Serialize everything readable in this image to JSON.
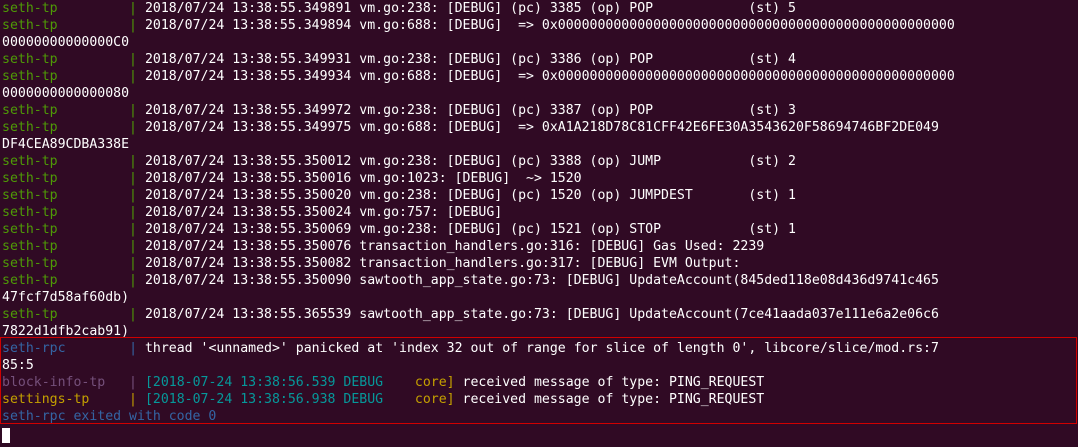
{
  "colors": {
    "background": "#300a24",
    "green": "#4e9a06",
    "blue": "#3465a4",
    "magenta": "#75507b",
    "yellow": "#c4a000",
    "cyan": "#06989a",
    "highlight_border": "#d00000"
  },
  "separator": "| ",
  "lines": [
    {
      "svc": "seth-tp",
      "color": "green",
      "msg": "2018/07/24 13:38:55.349891 vm.go:238: [DEBUG] (pc) 3385 (op) POP            (st) 5"
    },
    {
      "svc": "seth-tp",
      "color": "green",
      "msg": "2018/07/24 13:38:55.349894 vm.go:688: [DEBUG]  => 0x00000000000000000000000000000000000000000000000000"
    },
    {
      "cont": "00000000000000C0"
    },
    {
      "svc": "seth-tp",
      "color": "green",
      "msg": "2018/07/24 13:38:55.349931 vm.go:238: [DEBUG] (pc) 3386 (op) POP            (st) 4"
    },
    {
      "svc": "seth-tp",
      "color": "green",
      "msg": "2018/07/24 13:38:55.349934 vm.go:688: [DEBUG]  => 0x00000000000000000000000000000000000000000000000000"
    },
    {
      "cont": "0000000000000080"
    },
    {
      "svc": "seth-tp",
      "color": "green",
      "msg": "2018/07/24 13:38:55.349972 vm.go:238: [DEBUG] (pc) 3387 (op) POP            (st) 3"
    },
    {
      "svc": "seth-tp",
      "color": "green",
      "msg": "2018/07/24 13:38:55.349975 vm.go:688: [DEBUG]  => 0xA1A218D78C81CFF42E6FE30A3543620F58694746BF2DE049"
    },
    {
      "cont": "DF4CEA89CDBA338E"
    },
    {
      "svc": "seth-tp",
      "color": "green",
      "msg": "2018/07/24 13:38:55.350012 vm.go:238: [DEBUG] (pc) 3388 (op) JUMP           (st) 2"
    },
    {
      "svc": "seth-tp",
      "color": "green",
      "msg": "2018/07/24 13:38:55.350016 vm.go:1023: [DEBUG]  ~> 1520"
    },
    {
      "svc": "seth-tp",
      "color": "green",
      "msg": "2018/07/24 13:38:55.350020 vm.go:238: [DEBUG] (pc) 1520 (op) JUMPDEST       (st) 1"
    },
    {
      "svc": "seth-tp",
      "color": "green",
      "msg": "2018/07/24 13:38:55.350024 vm.go:757: [DEBUG]"
    },
    {
      "svc": "seth-tp",
      "color": "green",
      "msg": "2018/07/24 13:38:55.350069 vm.go:238: [DEBUG] (pc) 1521 (op) STOP           (st) 1"
    },
    {
      "svc": "seth-tp",
      "color": "green",
      "msg": "2018/07/24 13:38:55.350076 transaction_handlers.go:316: [DEBUG] Gas Used: 2239"
    },
    {
      "svc": "seth-tp",
      "color": "green",
      "msg": "2018/07/24 13:38:55.350082 transaction_handlers.go:317: [DEBUG] EVM Output:"
    },
    {
      "svc": "seth-tp",
      "color": "green",
      "msg": "2018/07/24 13:38:55.350090 sawtooth_app_state.go:73: [DEBUG] UpdateAccount(845ded118e08d436d9741c465"
    },
    {
      "cont": "47fcf7d58af60db)"
    },
    {
      "svc": "seth-tp",
      "color": "green",
      "msg": "2018/07/24 13:38:55.365539 sawtooth_app_state.go:73: [DEBUG] UpdateAccount(7ce41aada037e111e6a2e06c6"
    },
    {
      "cont": "7822d1dfb2cab91)"
    },
    {
      "svc": "seth-rpc",
      "color": "blue",
      "msg": "thread '<unnamed>' panicked at 'index 32 out of range for slice of length 0', libcore/slice/mod.rs:7"
    },
    {
      "cont": "85:5"
    },
    {
      "svc": "block-info-tp",
      "color": "magenta",
      "ts": "[2018-07-24 13:38:56.539 DEBUG    ",
      "mod": "core]",
      "rest": " received message of type: PING_REQUEST"
    },
    {
      "svc": "settings-tp",
      "color": "yellow",
      "ts": "[2018-07-24 13:38:56.938 DEBUG    ",
      "mod": "core]",
      "rest": " received message of type: PING_REQUEST"
    },
    {
      "plain": "seth-rpc exited with code 0",
      "color": "blue"
    }
  ]
}
